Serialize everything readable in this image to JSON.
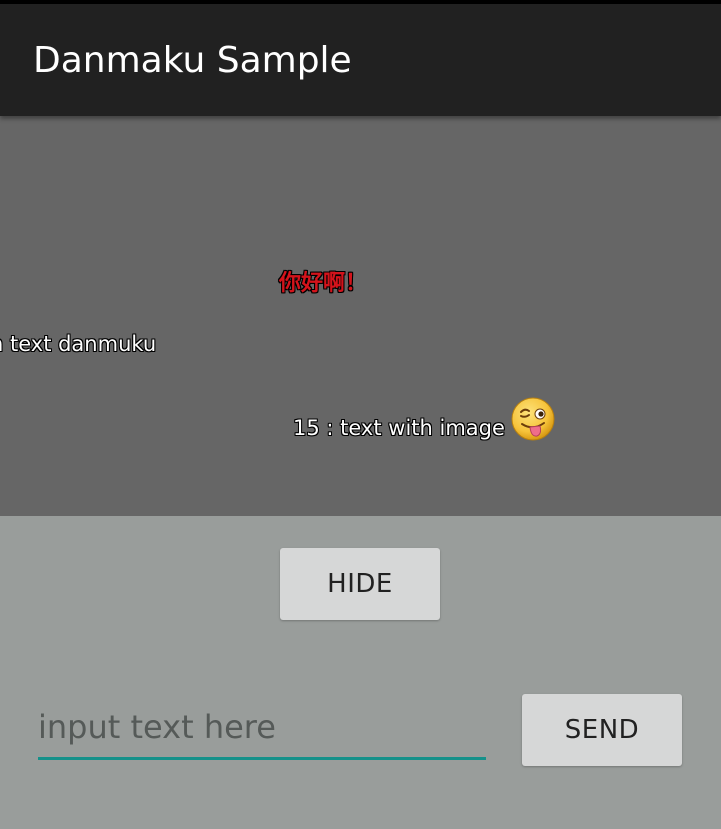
{
  "app_bar": {
    "title": "Danmaku Sample"
  },
  "danmaku": {
    "hello_text": "你好啊！",
    "hello_color": "#d4131b",
    "left_text": "n text danmuku",
    "image_text": "15 : text with image",
    "image_icon": "winking-tongue-emoji-icon"
  },
  "controls": {
    "hide_label": "HIDE",
    "input_placeholder": "input text here",
    "input_value": "",
    "send_label": "SEND",
    "accent_color": "#15918a"
  }
}
